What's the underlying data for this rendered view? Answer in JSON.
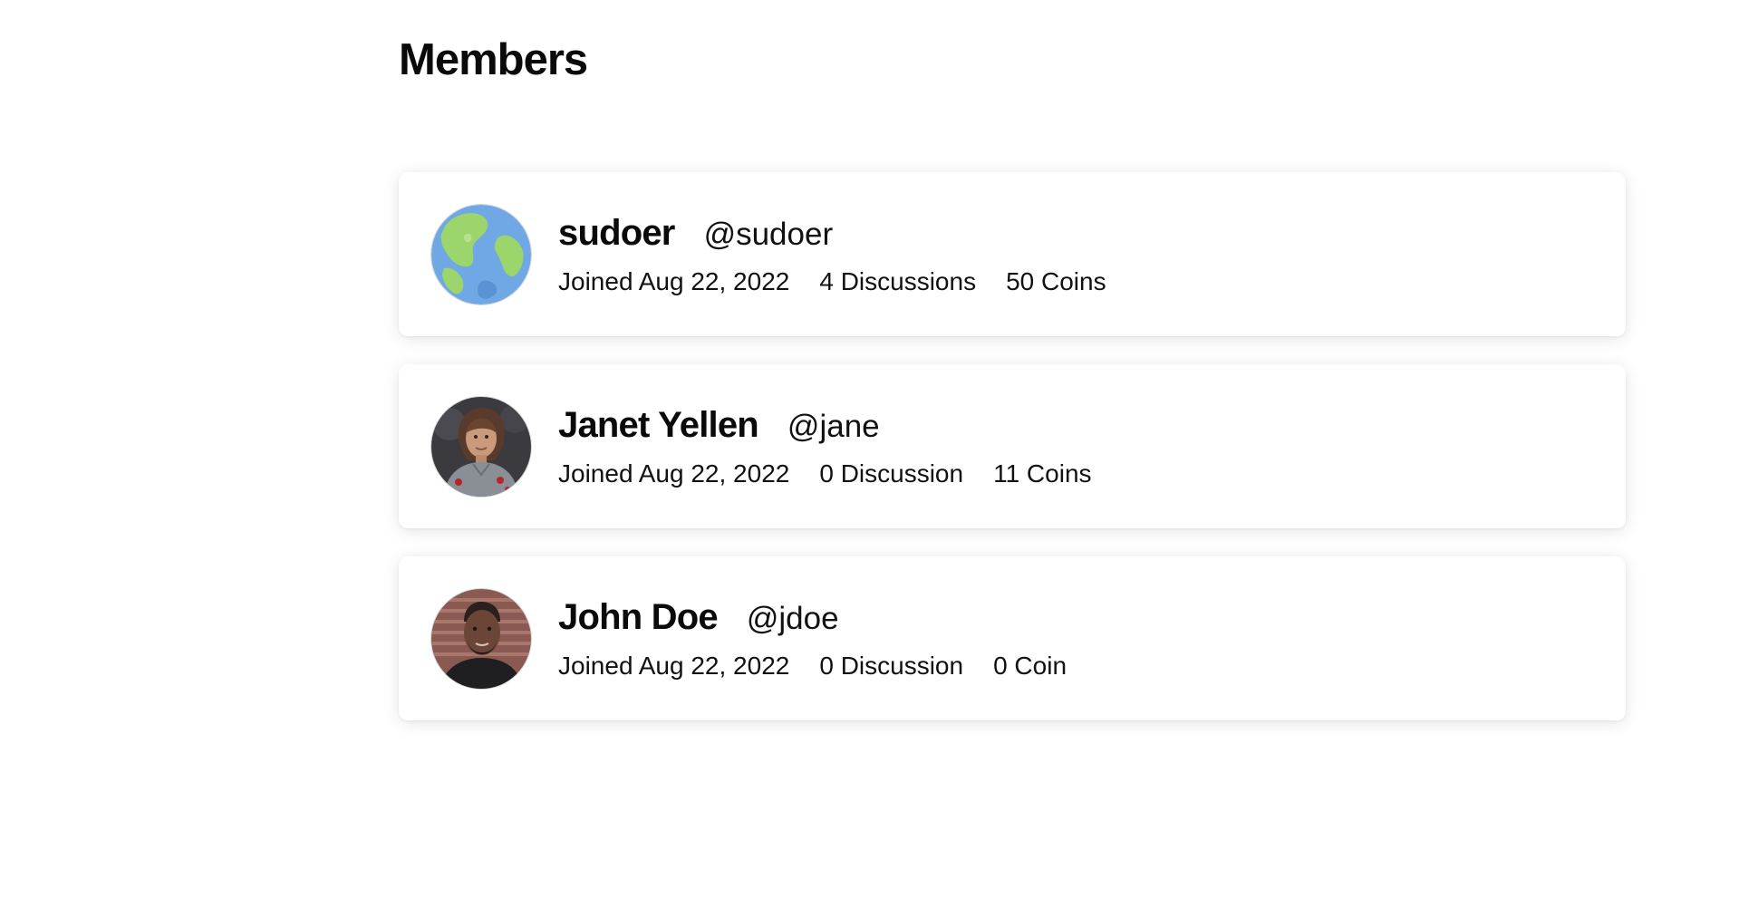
{
  "page": {
    "title": "Members"
  },
  "members": [
    {
      "name": "sudoer",
      "handle": "@sudoer",
      "joined": "Joined Aug 22, 2022",
      "discussions": "4 Discussions",
      "coins": "50 Coins",
      "avatar": "globe-avatar"
    },
    {
      "name": "Janet Yellen",
      "handle": "@jane",
      "joined": "Joined Aug 22, 2022",
      "discussions": "0 Discussion",
      "coins": "11 Coins",
      "avatar": "person-photo-avatar"
    },
    {
      "name": "John Doe",
      "handle": "@jdoe",
      "joined": "Joined Aug 22, 2022",
      "discussions": "0 Discussion",
      "coins": "0 Coin",
      "avatar": "person-photo-avatar"
    }
  ],
  "colors": {
    "card_background": "#ffffff",
    "page_background": "#ffffff",
    "text": "#111111",
    "globe_ocean": "#6fa8e4",
    "globe_land": "#9bd56b"
  }
}
